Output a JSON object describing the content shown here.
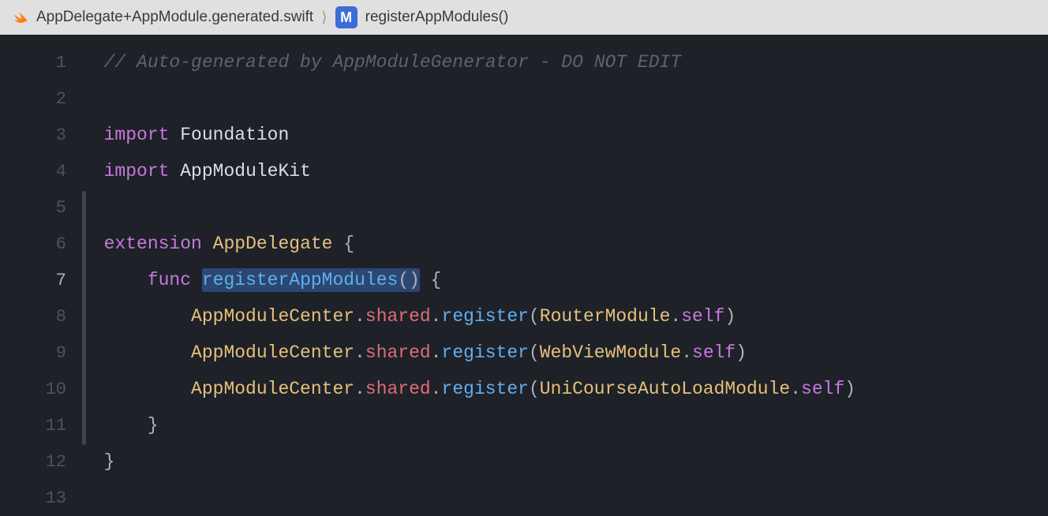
{
  "breadcrumb": {
    "file_name": "AppDelegate+AppModule.generated.swift",
    "separator": "⟩",
    "method_badge": "M",
    "method_name": "registerAppModules()"
  },
  "gutter": {
    "lines": [
      "1",
      "2",
      "3",
      "4",
      "5",
      "6",
      "7",
      "8",
      "9",
      "10",
      "11",
      "12",
      "13"
    ],
    "current_line": 7
  },
  "code": {
    "line1": {
      "comment": "// Auto-generated by AppModuleGenerator - DO NOT EDIT"
    },
    "line3": {
      "keyword": "import",
      "module": "Foundation"
    },
    "line4": {
      "keyword": "import",
      "module": "AppModuleKit"
    },
    "line6": {
      "keyword": "extension",
      "type": "AppDelegate",
      "brace": "{"
    },
    "line7": {
      "keyword": "func",
      "name": "registerAppModules",
      "parens": "()",
      "brace": "{"
    },
    "line8": {
      "type": "AppModuleCenter",
      "dot1": ".",
      "shared": "shared",
      "dot2": ".",
      "register": "register",
      "lparen": "(",
      "param_type": "RouterModule",
      "dot3": ".",
      "self_kw": "self",
      "rparen": ")"
    },
    "line9": {
      "type": "AppModuleCenter",
      "dot1": ".",
      "shared": "shared",
      "dot2": ".",
      "register": "register",
      "lparen": "(",
      "param_type": "WebViewModule",
      "dot3": ".",
      "self_kw": "self",
      "rparen": ")"
    },
    "line10": {
      "type": "AppModuleCenter",
      "dot1": ".",
      "shared": "shared",
      "dot2": ".",
      "register": "register",
      "lparen": "(",
      "param_type": "UniCourseAutoLoadModule",
      "dot3": ".",
      "self_kw": "self",
      "rparen": ")"
    },
    "line11": {
      "brace": "}"
    },
    "line12": {
      "brace": "}"
    }
  }
}
